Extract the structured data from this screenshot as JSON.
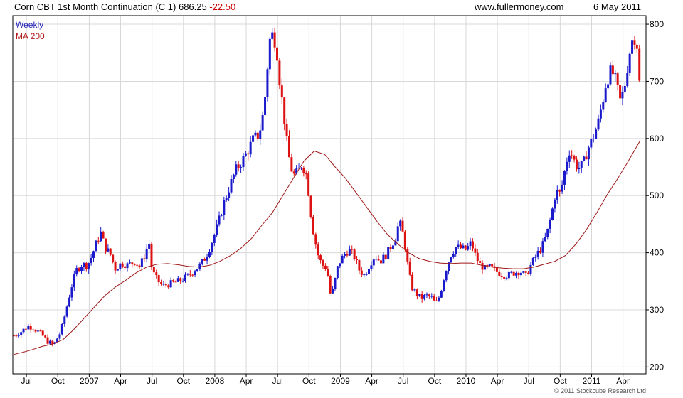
{
  "header": {
    "title": "Corn CBT 1st Month Continuation (C 1) 686.25",
    "change": "-22.50",
    "site": "www.fullermoney.com",
    "date": "6 May 2011"
  },
  "footer": {
    "copyright": "© 2011 Stockcube Research Ltd"
  },
  "colors": {
    "up": "#1a1acc",
    "down": "#dd1111",
    "ma": "#a01818",
    "grid": "#d8d8d8",
    "frame": "#000000"
  },
  "chart_data": {
    "type": "ohlc",
    "legend": [
      {
        "name": "Weekly",
        "color": "#2424b8"
      },
      {
        "name": "MA 200",
        "color": "#b01a1a"
      }
    ],
    "x_ticks": [
      {
        "label": "Jul",
        "t": 0.0
      },
      {
        "label": "Oct",
        "t": 3.0
      },
      {
        "label": "2007",
        "t": 6.0
      },
      {
        "label": "Apr",
        "t": 9.0
      },
      {
        "label": "Jul",
        "t": 12.0
      },
      {
        "label": "Oct",
        "t": 15.0
      },
      {
        "label": "2008",
        "t": 18.0
      },
      {
        "label": "Apr",
        "t": 21.0
      },
      {
        "label": "Jul",
        "t": 24.0
      },
      {
        "label": "Oct",
        "t": 27.0
      },
      {
        "label": "2009",
        "t": 30.0
      },
      {
        "label": "Apr",
        "t": 33.0
      },
      {
        "label": "Jul",
        "t": 36.0
      },
      {
        "label": "Oct",
        "t": 39.0
      },
      {
        "label": "2010",
        "t": 42.0
      },
      {
        "label": "Apr",
        "t": 45.0
      },
      {
        "label": "Jul",
        "t": 48.0
      },
      {
        "label": "Oct",
        "t": 51.0
      },
      {
        "label": "2011",
        "t": 54.0
      },
      {
        "label": "Apr",
        "t": 57.0
      }
    ],
    "y_ticks": [
      200,
      300,
      400,
      500,
      600,
      700,
      800
    ],
    "ylim": [
      188,
      815
    ],
    "xlim": [
      -1.3,
      59.2
    ],
    "grid": true,
    "series_anchors": [
      [
        -1.2,
        255
      ],
      [
        -0.5,
        262
      ],
      [
        0.2,
        272
      ],
      [
        0.8,
        266
      ],
      [
        1.4,
        258
      ],
      [
        2.0,
        245
      ],
      [
        2.6,
        238
      ],
      [
        3.3,
        262
      ],
      [
        3.8,
        300
      ],
      [
        4.3,
        340
      ],
      [
        4.8,
        370
      ],
      [
        5.3,
        380
      ],
      [
        5.8,
        377
      ],
      [
        6.2,
        392
      ],
      [
        6.7,
        418
      ],
      [
        7.1,
        435
      ],
      [
        7.5,
        410
      ],
      [
        8.0,
        398
      ],
      [
        8.5,
        372
      ],
      [
        9.1,
        382
      ],
      [
        9.7,
        378
      ],
      [
        10.3,
        385
      ],
      [
        10.8,
        376
      ],
      [
        11.3,
        395
      ],
      [
        11.7,
        420
      ],
      [
        12.0,
        368
      ],
      [
        12.5,
        352
      ],
      [
        13.0,
        342
      ],
      [
        13.6,
        345
      ],
      [
        14.2,
        348
      ],
      [
        14.8,
        352
      ],
      [
        15.5,
        360
      ],
      [
        16.1,
        370
      ],
      [
        16.7,
        380
      ],
      [
        17.2,
        395
      ],
      [
        17.7,
        418
      ],
      [
        18.3,
        450
      ],
      [
        18.9,
        490
      ],
      [
        19.5,
        520
      ],
      [
        20.0,
        545
      ],
      [
        20.6,
        560
      ],
      [
        21.2,
        580
      ],
      [
        21.7,
        600
      ],
      [
        22.2,
        605
      ],
      [
        22.7,
        650
      ],
      [
        23.0,
        720
      ],
      [
        23.3,
        780
      ],
      [
        23.6,
        782
      ],
      [
        23.9,
        760
      ],
      [
        24.2,
        700
      ],
      [
        24.6,
        640
      ],
      [
        24.9,
        590
      ],
      [
        25.2,
        555
      ],
      [
        25.5,
        535
      ],
      [
        25.9,
        540
      ],
      [
        26.3,
        555
      ],
      [
        26.8,
        535
      ],
      [
        27.1,
        480
      ],
      [
        27.4,
        440
      ],
      [
        27.8,
        400
      ],
      [
        28.2,
        380
      ],
      [
        28.7,
        372
      ],
      [
        29.1,
        320
      ],
      [
        29.4,
        345
      ],
      [
        29.8,
        380
      ],
      [
        30.3,
        395
      ],
      [
        30.8,
        405
      ],
      [
        31.3,
        395
      ],
      [
        31.8,
        370
      ],
      [
        32.3,
        360
      ],
      [
        32.8,
        380
      ],
      [
        33.3,
        395
      ],
      [
        33.8,
        385
      ],
      [
        34.3,
        395
      ],
      [
        34.8,
        410
      ],
      [
        35.3,
        428
      ],
      [
        35.6,
        455
      ],
      [
        35.9,
        440
      ],
      [
        36.2,
        410
      ],
      [
        36.5,
        370
      ],
      [
        36.8,
        340
      ],
      [
        37.2,
        330
      ],
      [
        37.7,
        320
      ],
      [
        38.2,
        325
      ],
      [
        38.7,
        322
      ],
      [
        39.1,
        310
      ],
      [
        39.5,
        325
      ],
      [
        40.0,
        365
      ],
      [
        40.5,
        395
      ],
      [
        41.0,
        410
      ],
      [
        41.5,
        408
      ],
      [
        42.0,
        405
      ],
      [
        42.5,
        418
      ],
      [
        42.9,
        395
      ],
      [
        43.3,
        380
      ],
      [
        43.8,
        372
      ],
      [
        44.3,
        375
      ],
      [
        44.8,
        368
      ],
      [
        45.4,
        362
      ],
      [
        46.0,
        360
      ],
      [
        46.6,
        365
      ],
      [
        47.2,
        368
      ],
      [
        47.7,
        358
      ],
      [
        48.2,
        378
      ],
      [
        48.7,
        395
      ],
      [
        49.2,
        408
      ],
      [
        49.7,
        430
      ],
      [
        50.2,
        470
      ],
      [
        50.6,
        510
      ],
      [
        50.9,
        500
      ],
      [
        51.2,
        520
      ],
      [
        51.6,
        560
      ],
      [
        51.9,
        580
      ],
      [
        52.3,
        562
      ],
      [
        52.7,
        548
      ],
      [
        53.2,
        555
      ],
      [
        53.6,
        580
      ],
      [
        54.1,
        600
      ],
      [
        54.6,
        625
      ],
      [
        55.0,
        660
      ],
      [
        55.4,
        700
      ],
      [
        55.9,
        720
      ],
      [
        56.3,
        700
      ],
      [
        56.7,
        665
      ],
      [
        57.1,
        685
      ],
      [
        57.5,
        735
      ],
      [
        57.8,
        770
      ],
      [
        58.1,
        778
      ],
      [
        58.4,
        760
      ],
      [
        58.6,
        686
      ]
    ],
    "ma_200": [
      [
        -1.2,
        222
      ],
      [
        -0.3,
        226
      ],
      [
        0.5,
        230
      ],
      [
        1.5,
        236
      ],
      [
        2.5,
        240
      ],
      [
        3.5,
        248
      ],
      [
        4.5,
        265
      ],
      [
        5.5,
        285
      ],
      [
        6.5,
        305
      ],
      [
        7.5,
        325
      ],
      [
        8.5,
        340
      ],
      [
        9.5,
        352
      ],
      [
        10.5,
        365
      ],
      [
        11.5,
        375
      ],
      [
        12.5,
        380
      ],
      [
        13.5,
        381
      ],
      [
        14.5,
        379
      ],
      [
        15.5,
        376
      ],
      [
        16.5,
        375
      ],
      [
        17.5,
        378
      ],
      [
        18.5,
        385
      ],
      [
        19.5,
        395
      ],
      [
        20.5,
        408
      ],
      [
        21.5,
        425
      ],
      [
        22.5,
        448
      ],
      [
        23.5,
        470
      ],
      [
        24.5,
        500
      ],
      [
        25.5,
        530
      ],
      [
        26.5,
        560
      ],
      [
        27.5,
        578
      ],
      [
        28.5,
        572
      ],
      [
        29.5,
        550
      ],
      [
        30.5,
        530
      ],
      [
        31.5,
        505
      ],
      [
        32.5,
        480
      ],
      [
        33.5,
        455
      ],
      [
        34.5,
        432
      ],
      [
        35.5,
        415
      ],
      [
        36.5,
        400
      ],
      [
        37.5,
        390
      ],
      [
        38.5,
        385
      ],
      [
        39.5,
        382
      ],
      [
        40.5,
        381
      ],
      [
        41.5,
        382
      ],
      [
        42.5,
        382
      ],
      [
        43.5,
        378
      ],
      [
        44.5,
        375
      ],
      [
        45.5,
        373
      ],
      [
        46.5,
        372
      ],
      [
        47.5,
        372
      ],
      [
        48.5,
        375
      ],
      [
        49.5,
        380
      ],
      [
        50.5,
        385
      ],
      [
        51.5,
        395
      ],
      [
        52.5,
        415
      ],
      [
        53.5,
        440
      ],
      [
        54.5,
        470
      ],
      [
        55.5,
        502
      ],
      [
        56.5,
        530
      ],
      [
        57.5,
        560
      ],
      [
        58.6,
        595
      ]
    ]
  }
}
